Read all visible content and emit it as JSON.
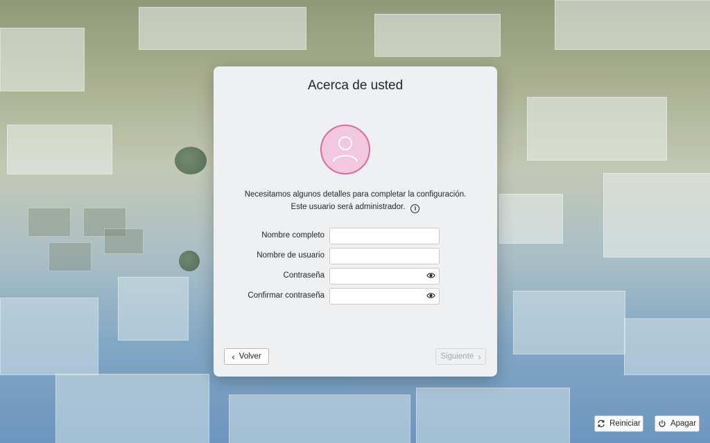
{
  "dialog": {
    "title": "Acerca de usted",
    "message_line1": "Necesitamos algunos detalles para completar la configuración.",
    "message_line2": "Este usuario será administrador.",
    "fields": [
      {
        "label": "Nombre completo",
        "value": "",
        "type": "text"
      },
      {
        "label": "Nombre de usuario",
        "value": "",
        "type": "text"
      },
      {
        "label": "Contraseña",
        "value": "",
        "type": "password"
      },
      {
        "label": "Confirmar contraseña",
        "value": "",
        "type": "password"
      }
    ],
    "back_label": "Volver",
    "next_label": "Siguiente",
    "next_enabled": false
  },
  "footer": {
    "restart_label": "Reiniciar",
    "power_label": "Apagar"
  },
  "icons": {
    "avatar": "user-avatar-icon",
    "info": "info-icon",
    "reveal": "eye-icon",
    "back": "chevron-left-icon",
    "next": "chevron-right-icon",
    "restart": "restart-icon",
    "power": "power-icon"
  },
  "colors": {
    "avatar_fill": "#f2c8de",
    "avatar_border": "#e0679f",
    "dialog_bg": "#eff0f1"
  }
}
